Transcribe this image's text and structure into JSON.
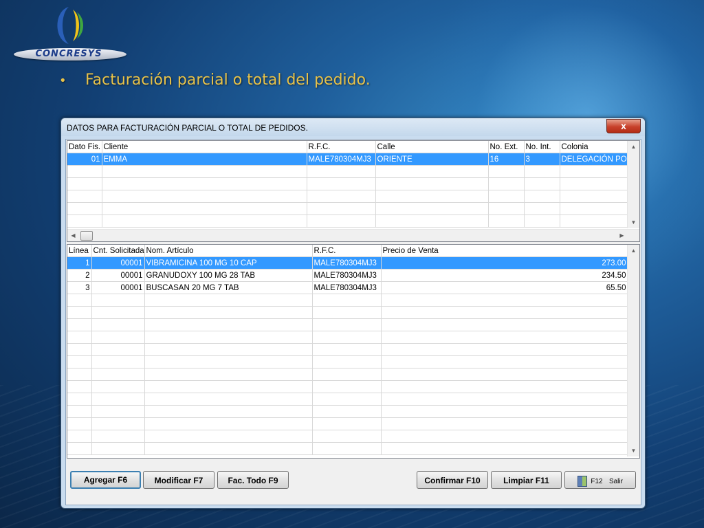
{
  "branding": {
    "logo_text": "CONCRESYS"
  },
  "slide": {
    "bullet": "•",
    "headline": "Facturación parcial o total del pedido."
  },
  "window": {
    "title": "DATOS PARA FACTURACIÓN PARCIAL O TOTAL DE  PEDIDOS.",
    "close_label": "x"
  },
  "clients_grid": {
    "columns": [
      "Dato Fis.",
      "Cliente",
      "R.F.C.",
      "Calle",
      "No. Ext.",
      "No. Int.",
      "Colonia"
    ],
    "rows": [
      {
        "dato_fis": "01",
        "cliente": "EMMA",
        "rfc": "MALE780304MJ3",
        "calle": "ORIENTE",
        "no_ext": "16",
        "no_int": "3",
        "colonia": "DELEGACIÓN PO"
      }
    ]
  },
  "items_grid": {
    "columns": [
      "Línea",
      "Cnt. Solicitada",
      "Nom. Artículo",
      "R.F.C.",
      "Precio de Venta"
    ],
    "rows": [
      {
        "linea": "1",
        "cantidad": "00001",
        "articulo": "VIBRAMICINA 100 MG 10 CAP",
        "rfc": "MALE780304MJ3",
        "precio": "273.00"
      },
      {
        "linea": "2",
        "cantidad": "00001",
        "articulo": "GRANUDOXY 100 MG 28 TAB",
        "rfc": "MALE780304MJ3",
        "precio": "234.50"
      },
      {
        "linea": "3",
        "cantidad": "00001",
        "articulo": "BUSCASAN 20 MG 7 TAB",
        "rfc": "MALE780304MJ3",
        "precio": "65.50"
      }
    ]
  },
  "buttons": {
    "agregar": "Agregar F6",
    "modificar": "Modificar F7",
    "fac_todo": "Fac. Todo F9",
    "confirmar": "Confirmar F10",
    "limpiar": "Limpiar F11",
    "salir_key": "F12",
    "salir": "Salir",
    "salir_icon": "exit-door-icon"
  },
  "colors": {
    "selection": "#3399ff",
    "headline": "#e7c24a",
    "close": "#c7402a"
  }
}
